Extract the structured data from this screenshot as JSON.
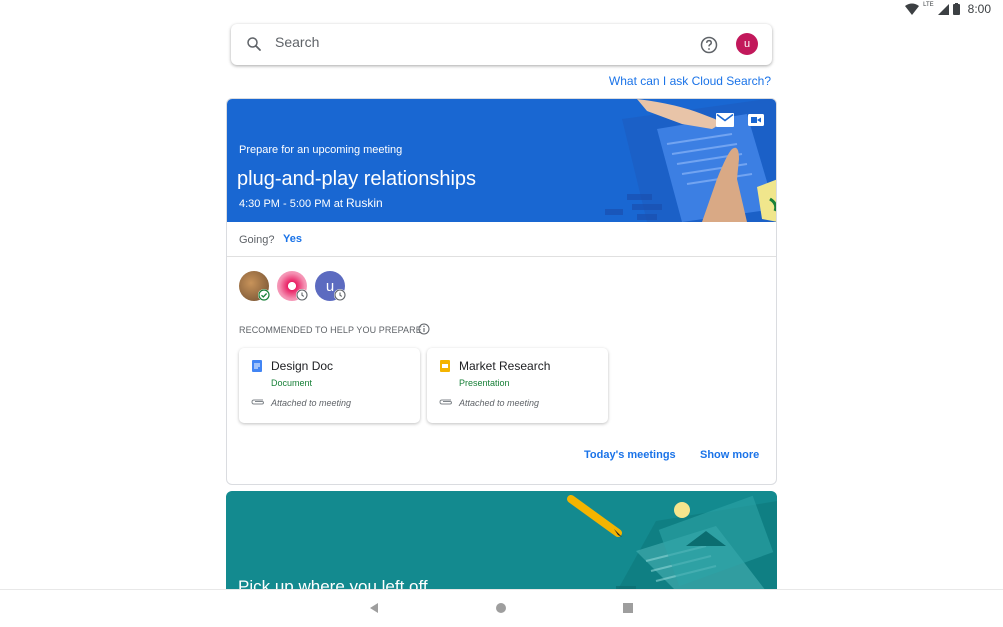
{
  "status": {
    "time": "8:00",
    "network": "LTE"
  },
  "search": {
    "placeholder": "Search",
    "avatar_letter": "u"
  },
  "ask_link": "What can I ask Cloud Search?",
  "meeting": {
    "kicker": "Prepare for an upcoming meeting",
    "title": "plug-and-play relationships",
    "time": "4:30 PM - 5:00 PM at",
    "location": "Ruskin",
    "going_label": "Going?",
    "going_value": "Yes",
    "attendees": [
      {
        "avatar": "photo",
        "status": "accepted"
      },
      {
        "avatar": "photo",
        "status": "pending"
      },
      {
        "avatar": "letter",
        "letter": "u",
        "status": "pending"
      }
    ],
    "recommended_label": "RECOMMENDED TO HELP YOU PREPARE",
    "docs": [
      {
        "name": "Design Doc",
        "type": "Document",
        "note": "Attached to meeting",
        "icon": "docs-icon",
        "icon_color": "#4285f4"
      },
      {
        "name": "Market Research",
        "type": "Presentation",
        "note": "Attached to meeting",
        "icon": "slides-icon",
        "icon_color": "#f4b400"
      }
    ],
    "todays_meetings": "Today's meetings",
    "show_more": "Show more",
    "header_color": "#1967d2"
  },
  "resume": {
    "title": "Pick up where you left off",
    "color": "#138a8f"
  },
  "colors": {
    "accent": "#1a73e8",
    "doc_type": "#188038",
    "avatar": "#c2185b"
  }
}
